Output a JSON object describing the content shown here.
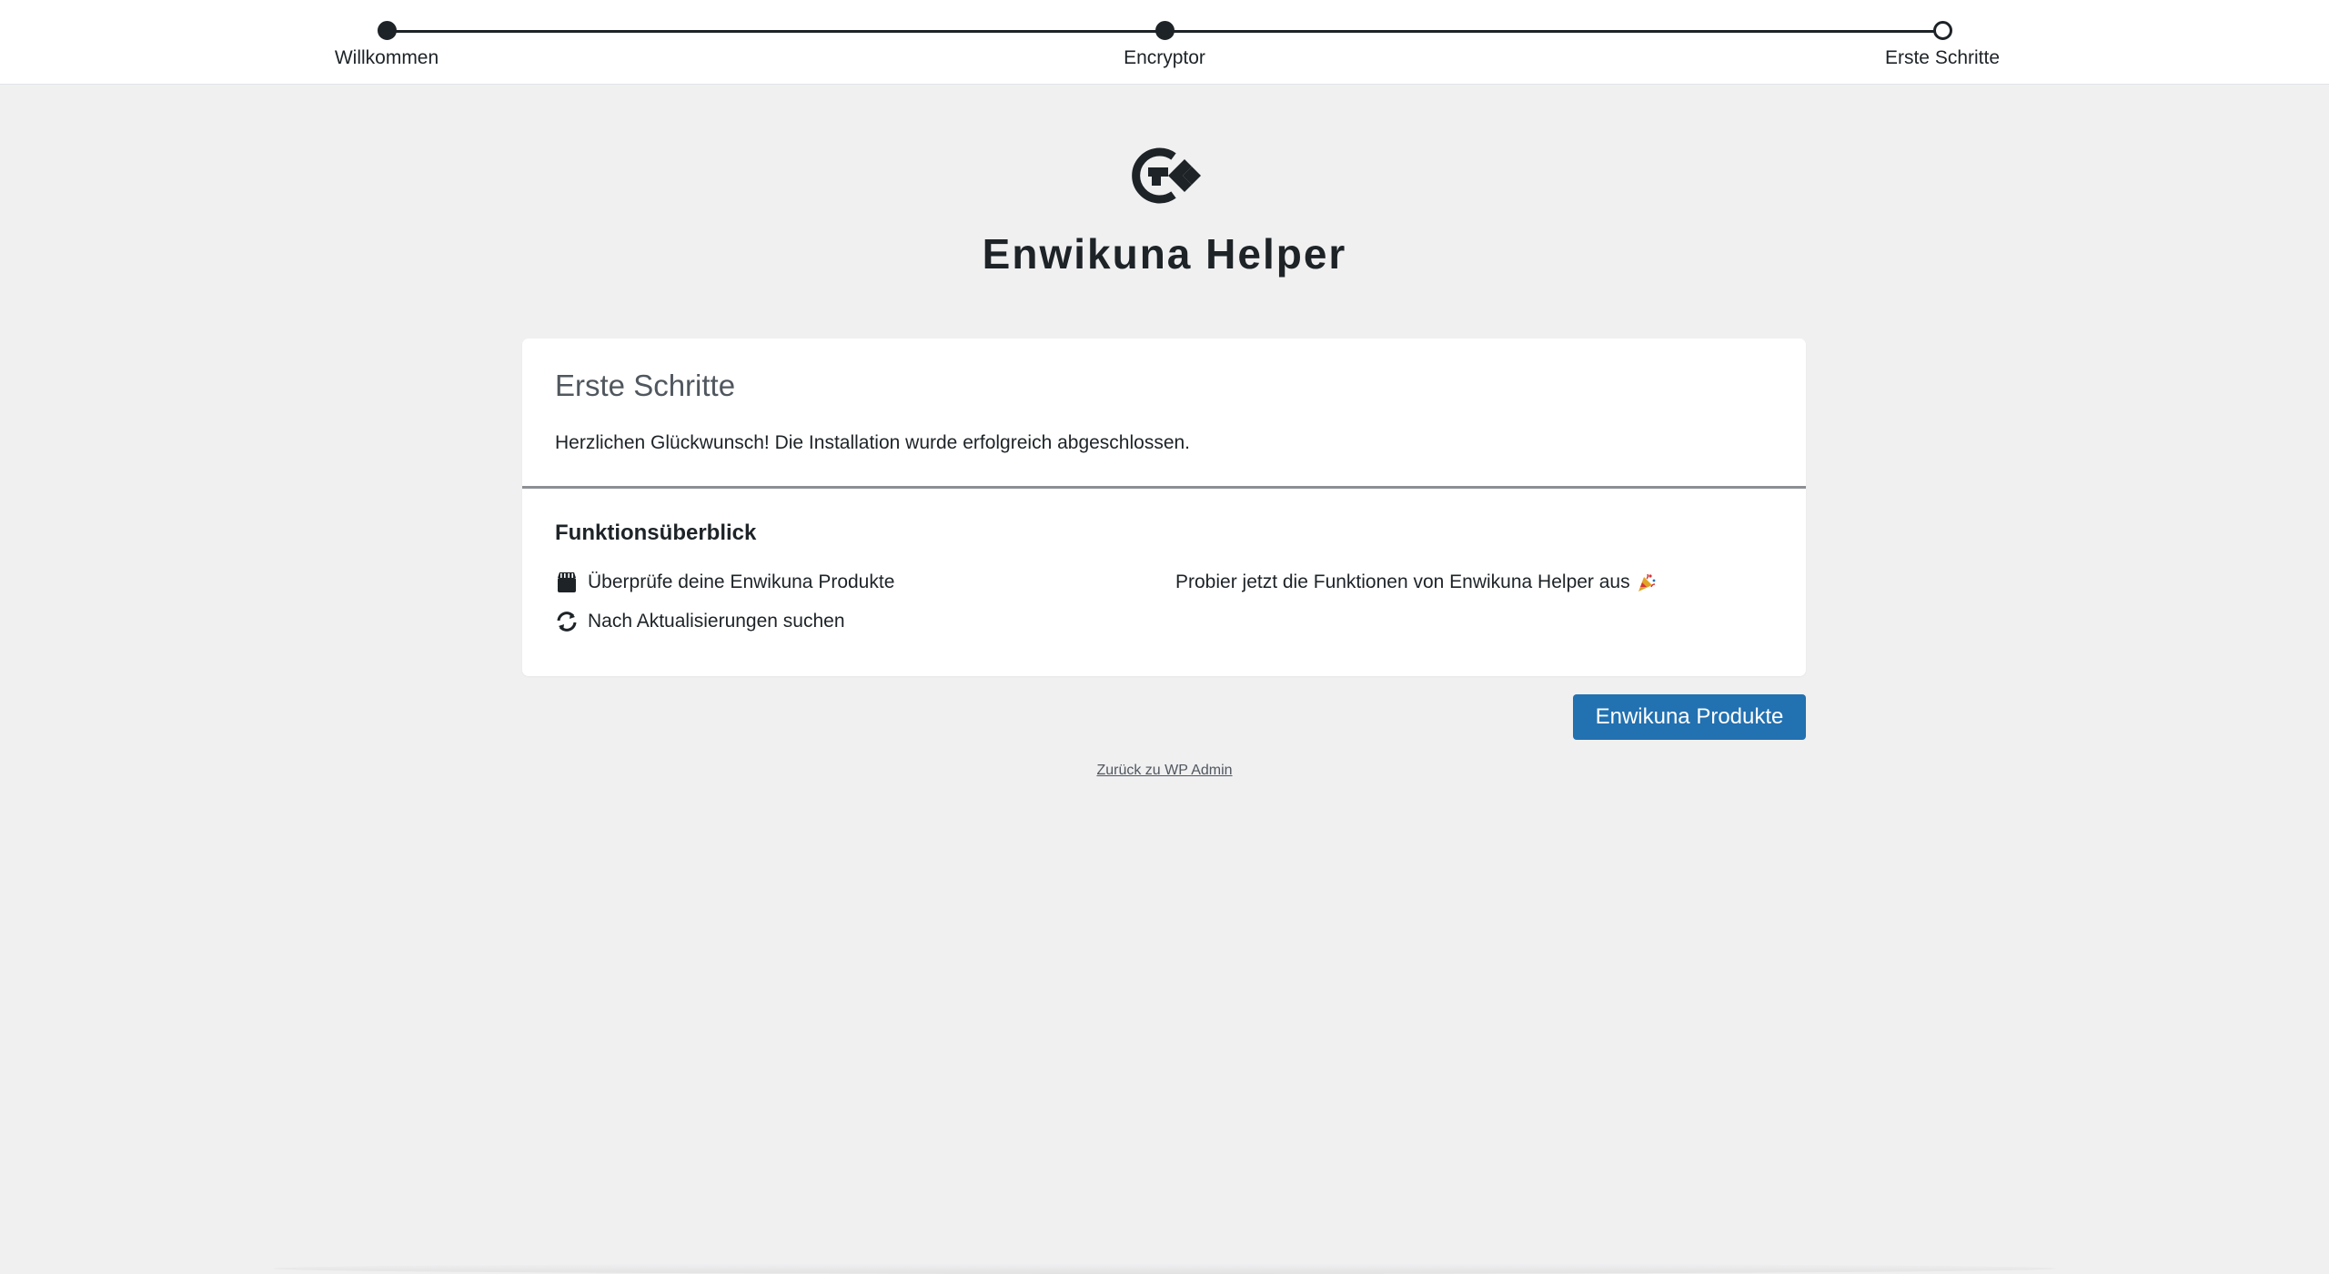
{
  "stepper": {
    "steps": [
      {
        "label": "Willkommen",
        "state": "completed"
      },
      {
        "label": "Encryptor",
        "state": "completed"
      },
      {
        "label": "Erste Schritte",
        "state": "current"
      }
    ]
  },
  "header": {
    "logo_icon": "enwikuna-logo-icon",
    "title": "Enwikuna Helper"
  },
  "card": {
    "title": "Erste Schritte",
    "intro": "Herzlichen Glückwunsch! Die Installation wurde erfolgreich abgeschlossen.",
    "section_title": "Funktionsüberblick",
    "features": [
      {
        "icon": "store-icon",
        "label": "Überprüfe deine Enwikuna Produkte"
      },
      {
        "icon": "update-icon",
        "label": "Nach Aktualisierungen suchen"
      }
    ],
    "promo": {
      "text": "Probier jetzt die Funktionen von Enwikuna Helper aus",
      "icon": "party-popper-icon"
    }
  },
  "actions": {
    "primary_button": "Enwikuna Produkte",
    "back_link": "Zurück zu WP Admin"
  },
  "colors": {
    "background": "#f0f0f1",
    "text": "#1d2327",
    "button": "#2271b1",
    "card": "#ffffff"
  }
}
